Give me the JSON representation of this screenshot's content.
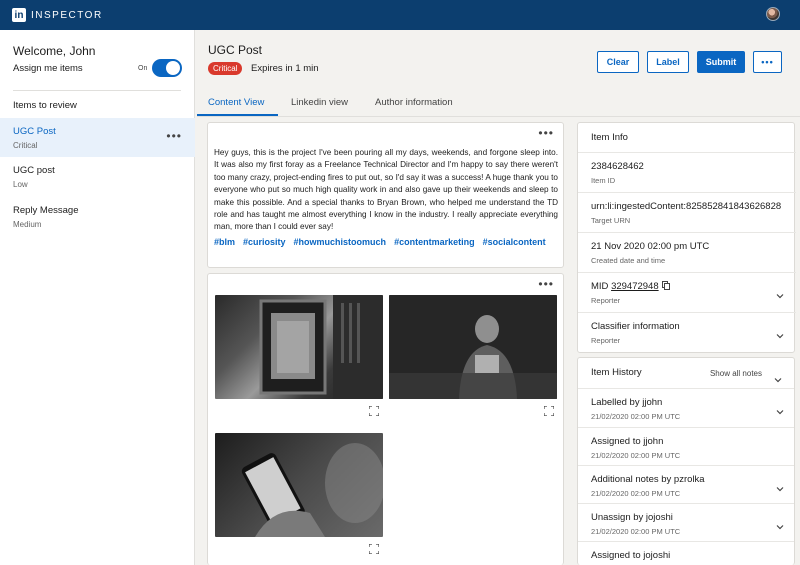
{
  "app": {
    "brand_logo": "in",
    "brand_name": "INSPECTOR"
  },
  "sidebar": {
    "welcome": "Welcome, John",
    "assign_label": "Assign me items",
    "toggle_state": "On",
    "items_heading": "Items to review",
    "items": [
      {
        "title": "UGC Post",
        "priority": "Critical"
      },
      {
        "title": "UGC post",
        "priority": "Low"
      },
      {
        "title": "Reply Message",
        "priority": "Medium"
      }
    ]
  },
  "header": {
    "title": "UGC Post",
    "badge": "Critical",
    "expires": "Expires in 1 min",
    "buttons": {
      "clear": "Clear",
      "label": "Label",
      "submit": "Submit",
      "more": "•••"
    }
  },
  "tabs": [
    "Content View",
    "Linkedin view",
    "Author information"
  ],
  "post": {
    "more": "•••",
    "text": "Hey guys, this is the project I've been pouring all my days, weekends, and forgone sleep into. It was also my first foray as a Freelance Technical Director and I'm happy to say there weren't too many crazy, project-ending fires to put out, so I'd say it was a success! A huge thank you to everyone who put so much high quality work in and also gave up their weekends and sleep to make this possible. And a special thanks to Bryan Brown, who helped me understand the TD role and has taught me almost everything I know in the industry. I really appreciate everything man, more than I could ever say!",
    "hashtags": [
      "#blm",
      "#curiosity",
      "#howmuchistoomuch",
      "#contentmarketing",
      "#socialcontent"
    ]
  },
  "media": {
    "more": "•••",
    "images": [
      "framed-photo",
      "person-reading",
      "phone-in-hand"
    ]
  },
  "item_info": {
    "heading": "Item Info",
    "rows": [
      {
        "value": "2384628462",
        "label": "Item ID"
      },
      {
        "value": "urn:li:ingestedContent:825852841843626828",
        "label": "Target URN"
      },
      {
        "value": "21 Nov 2020 02:00 pm UTC",
        "label": "Created date and time"
      },
      {
        "value_prefix": "MID ",
        "value_link": "329472948",
        "label": "Reporter"
      },
      {
        "value": "Classifier information",
        "label": "Reporter"
      }
    ]
  },
  "history": {
    "heading": "Item History",
    "show_all": "Show all notes",
    "entries": [
      {
        "title": "Labelled by jjohn",
        "time": "21/02/2020 02:00 PM UTC"
      },
      {
        "title": "Assigned to jjohn",
        "time": "21/02/2020 02:00 PM UTC"
      },
      {
        "title": "Additional notes by pzrolka",
        "time": "21/02/2020 02:00 PM UTC"
      },
      {
        "title": "Unassign by jojoshi",
        "time": "21/02/2020 02:00 PM UTC"
      },
      {
        "title": "Assigned to jojoshi",
        "time": ""
      }
    ]
  },
  "colors": {
    "brand": "#0c3e6f",
    "accent": "#0a66c2",
    "critical": "#d9392c"
  }
}
